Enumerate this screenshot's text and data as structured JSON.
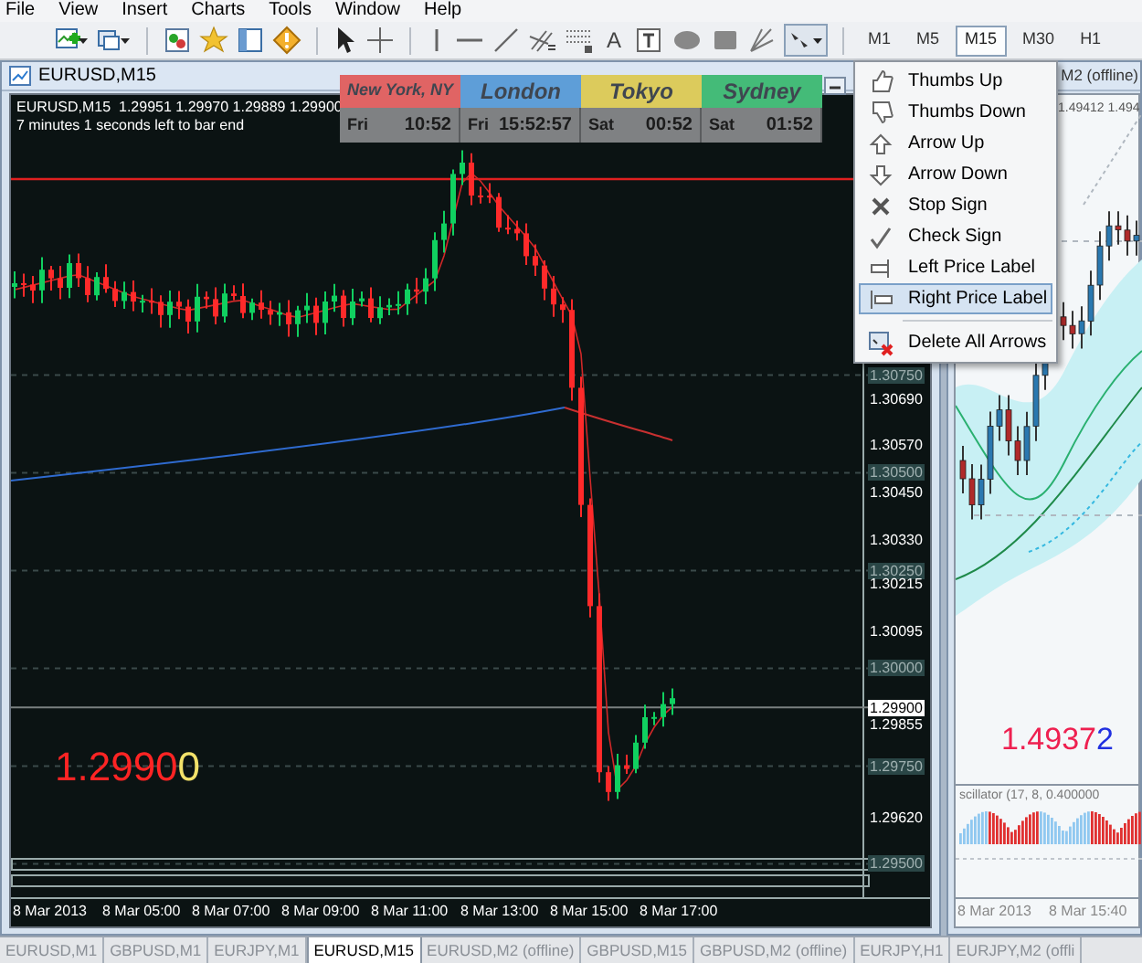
{
  "menu": [
    "File",
    "View",
    "Insert",
    "Charts",
    "Tools",
    "Window",
    "Help"
  ],
  "toolbar": {
    "text_tool": "A",
    "timeframes": [
      {
        "label": "M1",
        "selected": false
      },
      {
        "label": "M5",
        "selected": false
      },
      {
        "label": "M15",
        "selected": true
      },
      {
        "label": "M30",
        "selected": false
      },
      {
        "label": "H1",
        "selected": false
      }
    ]
  },
  "chart_window": {
    "title": "EURUSD,M15",
    "info_line": "EURUSD,M15  1.29951 1.29970 1.29889 1.29900",
    "timer": "7 minutes 1 seconds left to bar end",
    "sessions": [
      {
        "city": "New York, NY",
        "color": "#e06464",
        "day": "Fri",
        "time": "10:52"
      },
      {
        "city": "London",
        "color": "#5e9ed8",
        "day": "Fri",
        "time": "15:52:57"
      },
      {
        "city": "Tokyo",
        "color": "#dccb5c",
        "day": "Sat",
        "time": "00:52"
      },
      {
        "city": "Sydney",
        "color": "#44bb78",
        "day": "Sat",
        "time": "01:52"
      }
    ],
    "price_labels": [
      {
        "text": "1.30750",
        "kind": "level"
      },
      {
        "text": "1.30690",
        "kind": "tick"
      },
      {
        "text": "1.30570",
        "kind": "tick"
      },
      {
        "text": "1.30500",
        "kind": "level"
      },
      {
        "text": "1.30450",
        "kind": "tick"
      },
      {
        "text": "1.30330",
        "kind": "tick"
      },
      {
        "text": "1.30250",
        "kind": "level"
      },
      {
        "text": "1.30215",
        "kind": "tick"
      },
      {
        "text": "1.30095",
        "kind": "tick"
      },
      {
        "text": "1.30000",
        "kind": "level"
      },
      {
        "text": "1.29900",
        "kind": "current"
      },
      {
        "text": "1.29855",
        "kind": "tick"
      },
      {
        "text": "1.29750",
        "kind": "level"
      },
      {
        "text": "1.29620",
        "kind": "tick"
      },
      {
        "text": "1.29500",
        "kind": "level"
      }
    ],
    "time_labels": [
      "8 Mar 2013",
      "8 Mar 05:00",
      "8 Mar 07:00",
      "8 Mar 09:00",
      "8 Mar 11:00",
      "8 Mar 13:00",
      "8 Mar 15:00",
      "8 Mar 17:00"
    ],
    "big_price": {
      "digits": "1.2990",
      "last_digit": "0"
    }
  },
  "offline_window": {
    "title": "M2 (offline)",
    "info_line": "1.49412 1.494",
    "big_price": {
      "digits": "1.4937",
      "last_digit": "2"
    },
    "indicator": "scillator (17, 8, 0.400000",
    "time_labels": [
      "8 Mar 2013",
      "8 Mar 15:40"
    ]
  },
  "arrows_menu": {
    "items": [
      {
        "label": "Thumbs Up",
        "kind": "thumbs-up",
        "selected": false
      },
      {
        "label": "Thumbs Down",
        "kind": "thumbs-down",
        "selected": false
      },
      {
        "label": "Arrow Up",
        "kind": "arrow-up",
        "selected": false
      },
      {
        "label": "Arrow Down",
        "kind": "arrow-down",
        "selected": false
      },
      {
        "label": "Stop Sign",
        "kind": "stop",
        "selected": false
      },
      {
        "label": "Check Sign",
        "kind": "check",
        "selected": false
      },
      {
        "label": "Left Price Label",
        "kind": "left-label",
        "selected": false
      },
      {
        "label": "Right Price Label",
        "kind": "right-label",
        "selected": true
      },
      {
        "label": "Delete All Arrows",
        "kind": "delete",
        "selected": false,
        "separator_before": true
      }
    ]
  },
  "tabs": [
    {
      "label": "EURUSD,M1",
      "selected": false
    },
    {
      "label": "GBPUSD,M1",
      "selected": false
    },
    {
      "label": "EURJPY,M1",
      "selected": false
    },
    {
      "label": "EURUSD,M15",
      "selected": true
    },
    {
      "label": "EURUSD,M2 (offline)",
      "selected": false
    },
    {
      "label": "GBPUSD,M15",
      "selected": false
    },
    {
      "label": "GBPUSD,M2 (offline)",
      "selected": false
    },
    {
      "label": "EURJPY,H1",
      "selected": false
    },
    {
      "label": "EURJPY,M2 (offli",
      "selected": false
    }
  ]
}
